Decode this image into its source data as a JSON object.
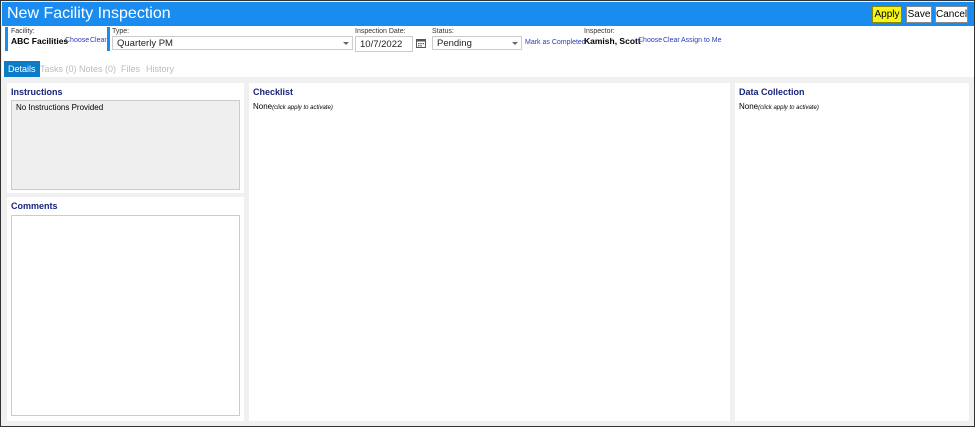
{
  "window": {
    "title": "New Facility Inspection"
  },
  "toolbar": {
    "apply_label": "Apply",
    "save_label": "Save",
    "cancel_label": "Cancel"
  },
  "facility": {
    "label": "Facility:",
    "value": "ABC Facilities",
    "choose": "Choose",
    "clear": "Clear"
  },
  "type": {
    "label": "Type:",
    "value": "Quarterly PM"
  },
  "inspection_date": {
    "label": "Inspection Date:",
    "value": "10/7/2022"
  },
  "status": {
    "label": "Status:",
    "value": "Pending",
    "mark_completed": "Mark as Completed"
  },
  "inspector": {
    "label": "Inspector:",
    "value": "Kamish, Scott",
    "choose": "Choose",
    "clear": "Clear",
    "assign": "Assign to Me"
  },
  "tabs": [
    {
      "label": "Details"
    },
    {
      "label": "Tasks (0)"
    },
    {
      "label": "Notes (0)"
    },
    {
      "label": "Files"
    },
    {
      "label": "History"
    }
  ],
  "instructions": {
    "title": "Instructions",
    "text": "No Instructions Provided"
  },
  "comments": {
    "title": "Comments",
    "value": ""
  },
  "checklist": {
    "title": "Checklist",
    "none": "None",
    "hint": "(click apply to activate)"
  },
  "data_collection": {
    "title": "Data Collection",
    "none": "None",
    "hint": "(click apply to activate)"
  },
  "colors": {
    "accent": "#1a8cf0",
    "apply_highlight": "#f5f51a",
    "tab_active": "#0c7cc8",
    "heading": "#17247a",
    "link": "#2a3bb8"
  }
}
